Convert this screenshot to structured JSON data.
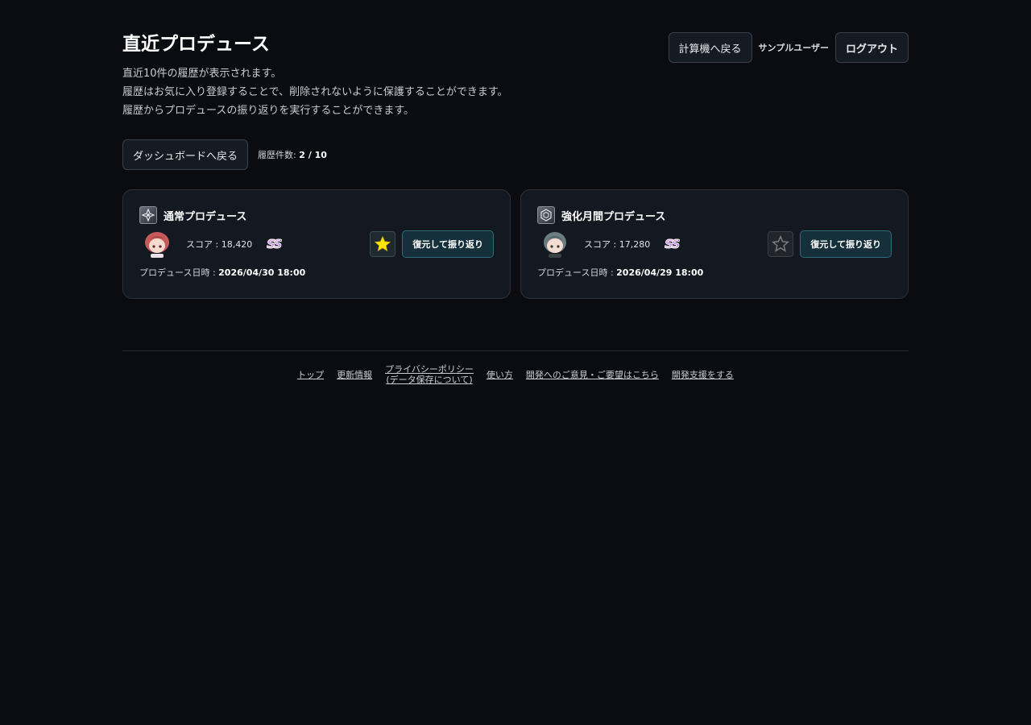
{
  "page": {
    "title": "直近プロデュース",
    "description": [
      "直近10件の履歴が表示されます。",
      "履歴はお気に入り登録することで、削除されないように保護することができます。",
      "履歴からプロデュースの振り返りを実行することができます。"
    ]
  },
  "header": {
    "calculator_button": "計算機へ戻る",
    "user_name": "サンプルユーザー",
    "logout_button": "ログアウト"
  },
  "toolbar": {
    "dashboard_button": "ダッシュボードへ戻る",
    "count_label": "履歴件数:",
    "count_value": "2 / 10"
  },
  "cards": [
    {
      "mode": "通常プロデュース",
      "score_label": "スコア :",
      "score": "18,420",
      "rank": "SS",
      "favorite": true,
      "restore_button": "復元して振り返り",
      "date_label": "プロデュース日時 :",
      "date": "2026/04/30 18:00",
      "avatar_color": "#c65a5a",
      "icon": "normal-produce-icon"
    },
    {
      "mode": "強化月間プロデュース",
      "score_label": "スコア :",
      "score": "17,280",
      "rank": "SS",
      "favorite": false,
      "restore_button": "復元して振り返り",
      "date_label": "プロデュース日時 :",
      "date": "2026/04/29 18:00",
      "avatar_color": "#6a7d80",
      "icon": "enhanced-month-produce-icon"
    }
  ],
  "footer": {
    "links": [
      "トップ",
      "更新情報",
      "プライバシーポリシー",
      "(データ保存について)",
      "使い方",
      "開発へのご意見・ご要望はこちら",
      "開発支援をする"
    ]
  },
  "colors": {
    "background": "#0a0c12",
    "favorite_star": "#ffe600",
    "restore_accent": "#2f6b78"
  }
}
